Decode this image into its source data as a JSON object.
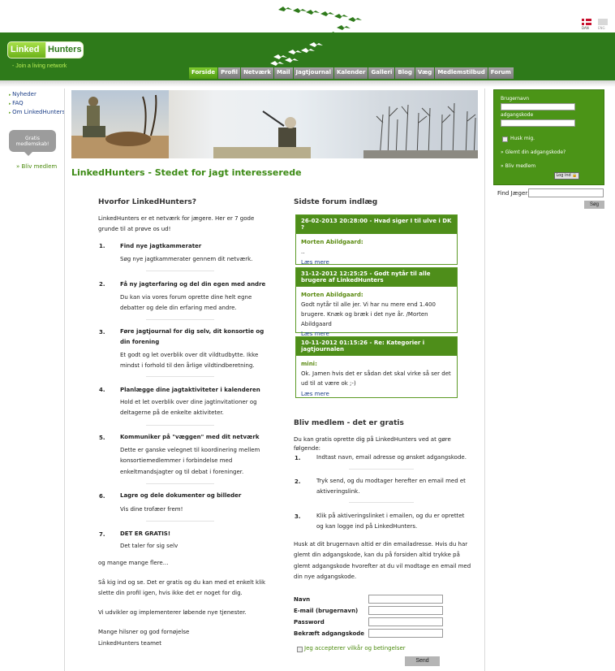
{
  "header": {
    "logo_linked": "Linked",
    "logo_hunters": "Hunters",
    "tagline": "- Join a living network",
    "lang_dan": "DAN",
    "lang_eng": "ENG"
  },
  "nav": {
    "items": [
      "Forside",
      "Profil",
      "Netværk",
      "Mail",
      "Jagtjournal",
      "Kalender",
      "Galleri",
      "Blog",
      "Væg",
      "Medlemstilbud",
      "Forum"
    ]
  },
  "left": {
    "links": [
      "Nyheder",
      "FAQ",
      "Om LinkedHunters"
    ],
    "signup_bubble": "Gratis medlemskab!",
    "become_member": "» Bliv medlem"
  },
  "main_title": "LinkedHunters - Stedet for jagt interesserede",
  "login": {
    "username_label": "Brugernavn",
    "password_label": "adgangskode",
    "remember": "Husk mig.",
    "forgot": "» Glemt din adgangskode?",
    "become_member": "» Bliv medlem",
    "login_button": "Log ind"
  },
  "search": {
    "label": "Find Jæger:",
    "button": "Søg"
  },
  "why": {
    "title": "Hvorfor LinkedHunters?",
    "intro": "LinkedHunters er et netværk for jægere. Her er 7 gode grunde til at prøve os ud!",
    "items": [
      {
        "num": "1.",
        "head": "Find nye jagtkammerater",
        "body": "Søg nye jagtkammerater gennem dit netværk."
      },
      {
        "num": "2.",
        "head": "Få ny jagterfaring og del din egen med andre",
        "body": "Du kan via vores forum oprette dine helt egne debatter og dele din erfaring med andre."
      },
      {
        "num": "3.",
        "head": "Føre jagtjournal for dig selv, dit konsortie og din forening",
        "body": "Et godt og let overblik over dit vildtudbytte. Ikke mindst i forhold til den årlige vildtindberetning."
      },
      {
        "num": "4.",
        "head": "Planlægge dine jagtaktiviteter i kalenderen",
        "body": "Hold et let overblik over dine jagtinvitationer og deltagerne på de enkelte aktiviteter."
      },
      {
        "num": "5.",
        "head": "Kommuniker på \"væggen\" med dit netværk",
        "body": "Dette er ganske velegnet til koordinering mellem konsortiemedlemmer i forbindelse med enkeltmandsjagter og til debat i foreninger."
      },
      {
        "num": "6.",
        "head": "Lagre og dele dokumenter og billeder",
        "body": "Vis dine trofæer frem!"
      },
      {
        "num": "7.",
        "head": "DET ER GRATIS!",
        "body": "Det taler for sig selv"
      }
    ],
    "closing": [
      "og mange mange flere...",
      "Så kig ind og se. Det er gratis og du kan med et enkelt klik slette din profil igen, hvis ikke det er noget for dig.",
      "Vi udvikler og implementerer løbende nye tjenester.",
      "Mange hilsner og god fornøjelse\nLinkedHunters teamet"
    ]
  },
  "forum": {
    "title": "Sidste forum indlæg",
    "posts": [
      {
        "head": "26-02-2013 20:28:00 - Hvad siger I til ulve i DK ?",
        "author": "Morten Abildgaard:",
        "text": "..",
        "more": "Læs mere"
      },
      {
        "head": "31-12-2012 12:25:25 - Godt nytår til alle brugere af LinkedHunters",
        "author": "Morten Abildgaard:",
        "text": "Godt nytår til alle jer. Vi har nu mere end 1.400 brugere. Knæk og bræk i det nye år. /Morten Abildgaard",
        "more": "Læs mere"
      },
      {
        "head": "10-11-2012 01:15:26 - Re: Kategorier i jagtjournalen",
        "author": "mini:",
        "text": "Ok. Jamen hvis det er sådan det skal virke så ser det ud til at være ok ;-)",
        "more": "Læs mere"
      }
    ]
  },
  "member": {
    "title": "Bliv medlem - det er gratis",
    "intro": "Du kan gratis oprette dig på LinkedHunters ved at gøre følgende:",
    "steps": [
      {
        "num": "1.",
        "body": "Indtast navn, email adresse og ønsket adgangskode."
      },
      {
        "num": "2.",
        "body": "Tryk send, og du modtager herefter en email med et aktiveringslink."
      },
      {
        "num": "3.",
        "body": "Klik på aktiveringslinket i emailen, og du er oprettet og kan logge ind på LinkedHunters."
      }
    ],
    "note": "Husk at dit brugernavn altid er din emailadresse. Hvis du har glemt din adgangskode, kan du på forsiden altid trykke på glemt adgangskode hvorefter at du vil modtage en email med din nye adgangskode.",
    "form": {
      "name": "Navn",
      "email": "E-mail (brugernavn)",
      "password": "Password",
      "confirm": "Bekræft adgangskode",
      "terms": "Jeg accepterer vilkår og betingelser",
      "send": "Send"
    }
  }
}
